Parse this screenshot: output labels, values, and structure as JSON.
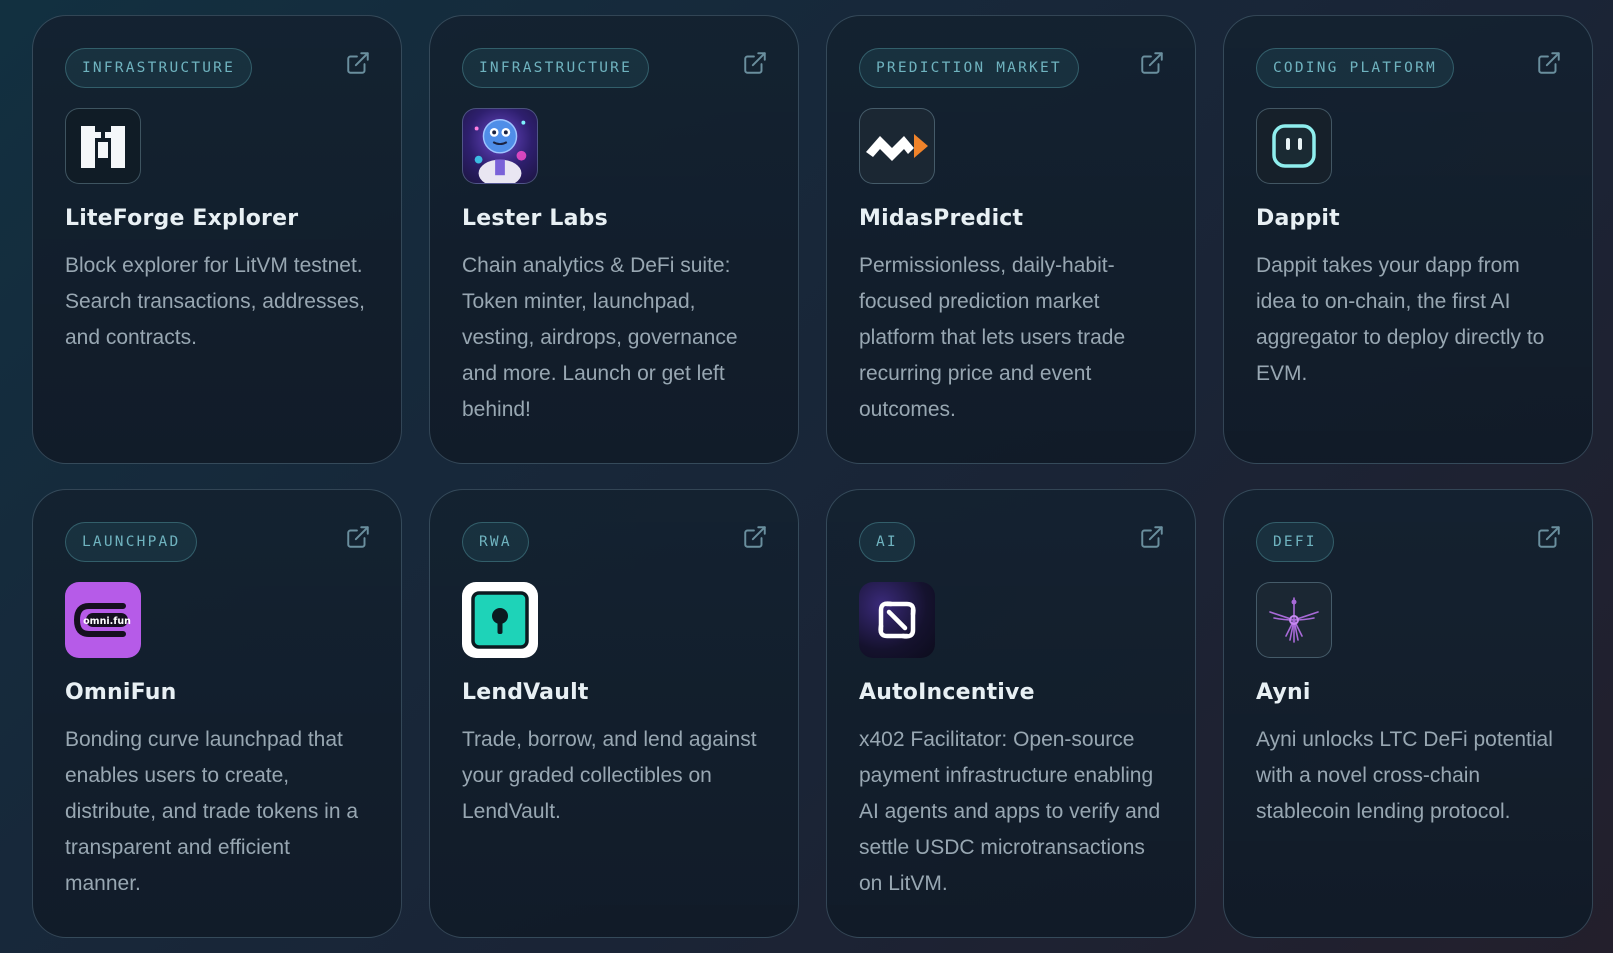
{
  "cards": [
    {
      "category": "INFRASTRUCTURE",
      "name": "LiteForge Explorer",
      "description": "Block explorer for LitVM testnet. Search transactions, addresses, and contracts."
    },
    {
      "category": "INFRASTRUCTURE",
      "name": "Lester Labs",
      "description": "Chain analytics & DeFi suite: Token minter, launchpad, vesting, airdrops, governance and more. Launch or get left behind!"
    },
    {
      "category": "PREDICTION MARKET",
      "name": "MidasPredict",
      "description": "Permissionless, daily-habit-focused prediction market platform that lets users trade recurring price and event outcomes."
    },
    {
      "category": "CODING PLATFORM",
      "name": "Dappit",
      "description": "Dappit takes your dapp from idea to on-chain, the first AI aggregator to deploy directly to EVM."
    },
    {
      "category": "LAUNCHPAD",
      "name": "OmniFun",
      "description": "Bonding curve launchpad that enables users to create, distribute, and trade tokens in a transparent and efficient manner.",
      "logo_text": "omni.fun"
    },
    {
      "category": "RWA",
      "name": "LendVault",
      "description": "Trade, borrow, and lend against your graded collectibles on LendVault."
    },
    {
      "category": "AI",
      "name": "AutoIncentive",
      "description": "x402 Facilitator: Open-source payment infrastructure enabling AI agents and apps to verify and settle USDC microtransactions on LitVM."
    },
    {
      "category": "DEFI",
      "name": "Ayni",
      "description": "Ayni unlocks LTC DeFi potential with a novel cross-chain stablecoin lending protocol."
    }
  ],
  "icons": {
    "external_link": "external-link-icon",
    "logos": [
      "liteforge-logo",
      "lester-labs-logo",
      "midaspredict-logo",
      "dappit-logo",
      "omnifun-logo",
      "lendvault-logo",
      "autoincentive-logo",
      "ayni-logo"
    ]
  },
  "colors": {
    "badge_text": "#6fb3bf",
    "title_text": "#e8f0f4",
    "desc_text": "#98a7b2",
    "omnifun_purple": "#b65be8",
    "lendvault_teal": "#1ed3b8",
    "midas_orange": "#f0832a"
  }
}
